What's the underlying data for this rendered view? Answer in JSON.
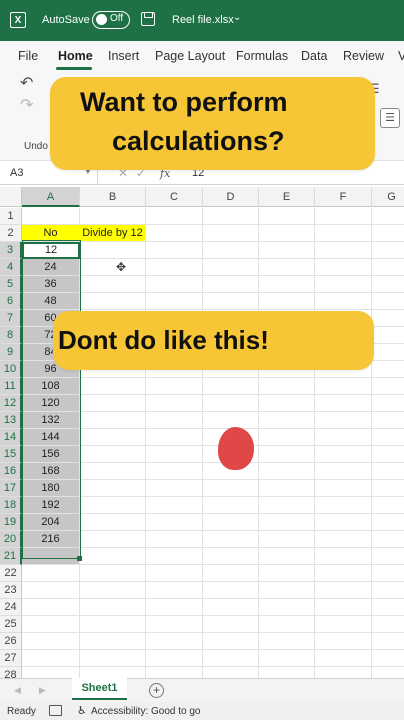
{
  "titlebar": {
    "app_icon": "excel-icon",
    "autosave_label": "AutoSave",
    "toggle_state": "Off",
    "filename": "Reel file.xlsx",
    "chevron": "⌄"
  },
  "menu": [
    "File",
    "Home",
    "Insert",
    "Page Layout",
    "Formulas",
    "Data",
    "Review",
    "V"
  ],
  "ribbon": {
    "undo_label": "Undo"
  },
  "formula_bar": {
    "name_box": "A3",
    "fx": "fx",
    "value": "12"
  },
  "grid": {
    "columns": [
      "A",
      "B",
      "C",
      "D",
      "E",
      "F",
      "G"
    ],
    "rows": [
      "1",
      "2",
      "3",
      "4",
      "5",
      "6",
      "7",
      "8",
      "9",
      "10",
      "11",
      "12",
      "13",
      "14",
      "15",
      "16",
      "17",
      "18",
      "19",
      "20",
      "21",
      "22",
      "23",
      "24",
      "25",
      "26",
      "27",
      "28"
    ],
    "header_a": "No",
    "header_b": "Divide by 12",
    "values": [
      "12",
      "24",
      "36",
      "48",
      "60",
      "72",
      "84",
      "96",
      "108",
      "120",
      "132",
      "144",
      "156",
      "168",
      "180",
      "192",
      "204",
      "216"
    ]
  },
  "callouts": {
    "top_line1": "Want to perform",
    "top_line2": "calculations?",
    "bottom": "Dont do like this!"
  },
  "sheet_tabs": {
    "active": "Sheet1",
    "add": "+"
  },
  "status": {
    "ready": "Ready",
    "accessibility": "Accessibility: Good to go"
  },
  "colors": {
    "excel_green": "#1e7145",
    "callout_yellow": "#f7c637",
    "cell_highlight": "#ffff00",
    "red_mark": "#e04848"
  }
}
